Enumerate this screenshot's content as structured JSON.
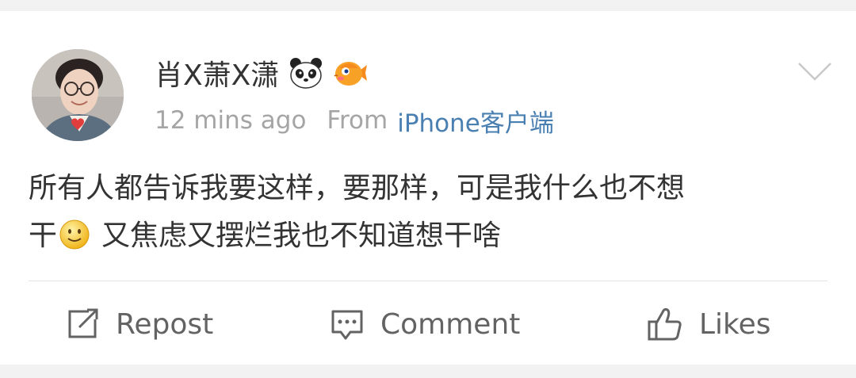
{
  "post": {
    "username": "肖X萧X潇",
    "timestamp": "12 mins ago",
    "from_label": "From",
    "source": "iPhone客户端",
    "content_line1": "所有人都告诉我要这样，要那样，可是我什么也不想",
    "content_line2_a": "干",
    "content_line2_b": "又焦虑又摆烂我也不知道想干啥",
    "badges": [
      "panda-icon",
      "fish-icon"
    ],
    "inline_emoji": "smile-emoji-icon"
  },
  "actions": {
    "repost_label": "Repost",
    "comment_label": "Comment",
    "likes_label": "Likes"
  },
  "colors": {
    "text": "#333333",
    "meta": "#a5a5a5",
    "link": "#4a7fb2",
    "action": "#636363",
    "background": "#f2f2f2",
    "card": "#ffffff"
  }
}
